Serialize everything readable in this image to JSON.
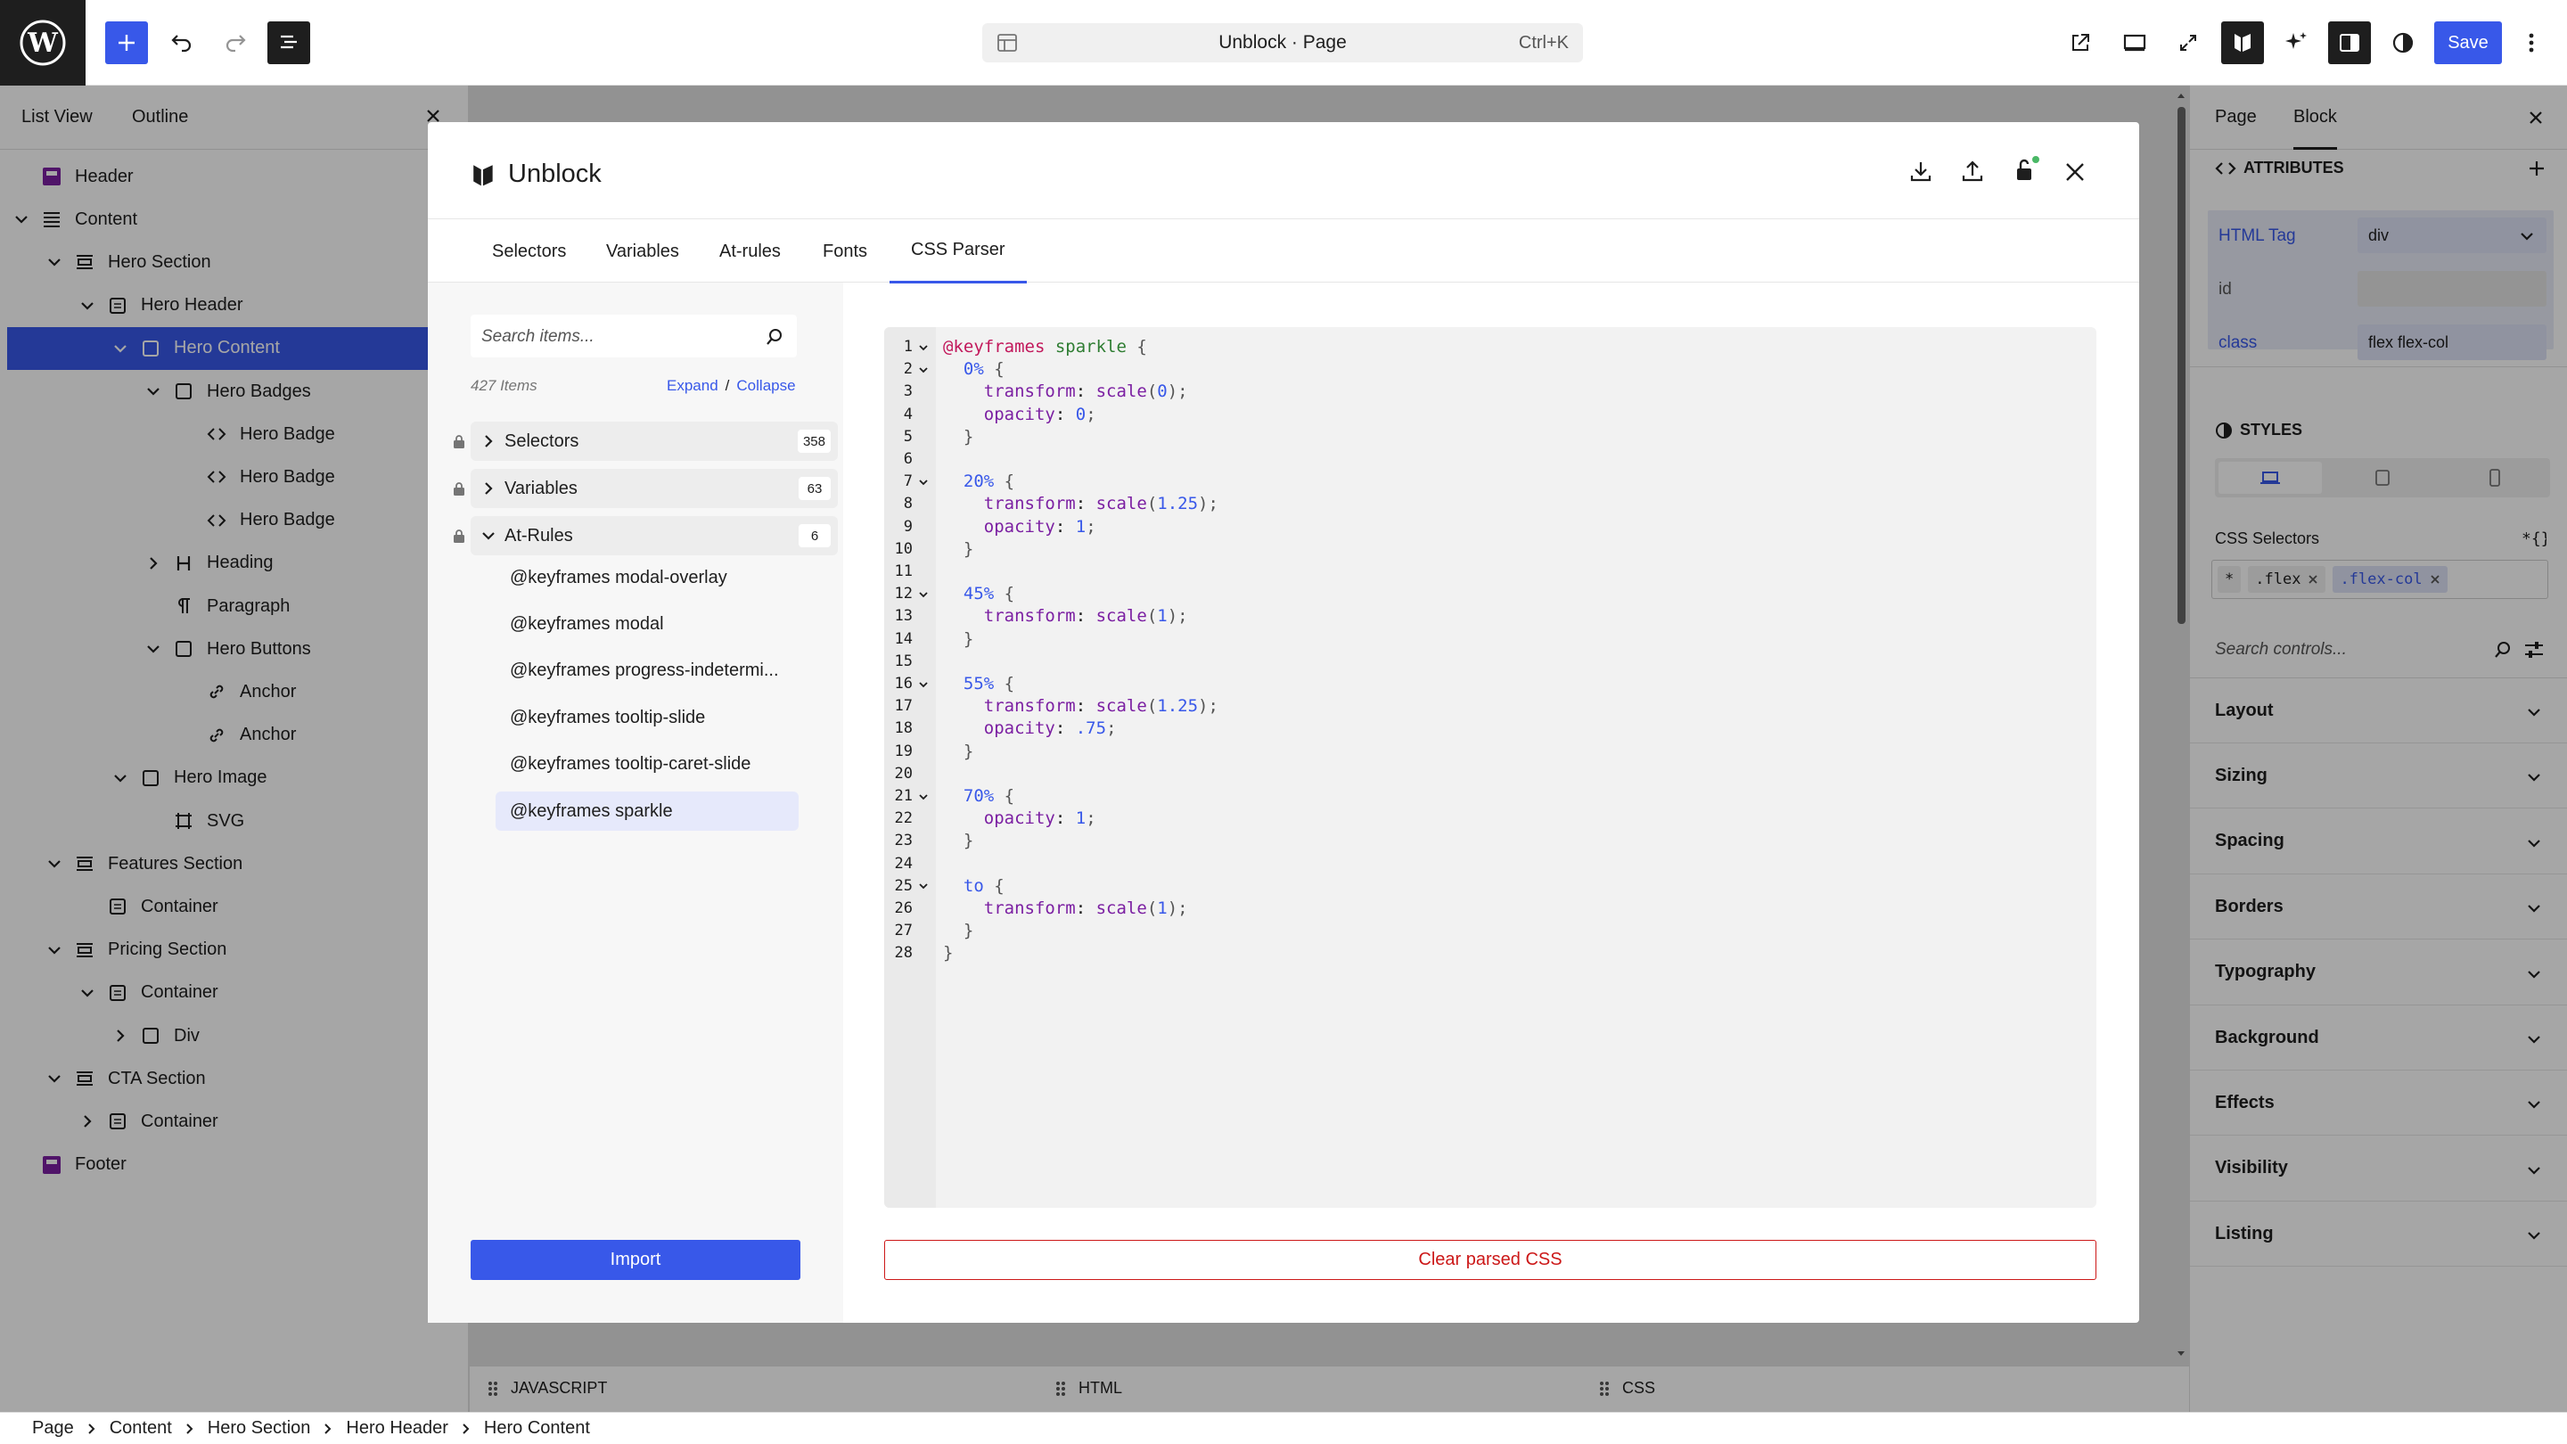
{
  "topbar": {
    "title": "Unblock · Page",
    "shortcut": "Ctrl+K",
    "save_label": "Save",
    "accent": "#3858e9"
  },
  "left_panel": {
    "tabs": [
      "List View",
      "Outline"
    ],
    "tree": [
      {
        "label": "Header",
        "depth": 0,
        "icon": "template-part-icon",
        "chev": "none"
      },
      {
        "label": "Content",
        "depth": 0,
        "icon": "paragraph-lines-icon",
        "chev": "down"
      },
      {
        "label": "Hero Section",
        "depth": 1,
        "icon": "section-icon",
        "chev": "down"
      },
      {
        "label": "Hero Header",
        "depth": 2,
        "icon": "container-icon",
        "chev": "down"
      },
      {
        "label": "Hero Content",
        "depth": 3,
        "icon": "div-icon",
        "chev": "down",
        "selected": true
      },
      {
        "label": "Hero Badges",
        "depth": 4,
        "icon": "div-icon",
        "chev": "down"
      },
      {
        "label": "Hero Badge",
        "depth": 5,
        "icon": "code-icon",
        "chev": "none"
      },
      {
        "label": "Hero Badge",
        "depth": 5,
        "icon": "code-icon",
        "chev": "none"
      },
      {
        "label": "Hero Badge",
        "depth": 5,
        "icon": "code-icon",
        "chev": "none"
      },
      {
        "label": "Heading",
        "depth": 4,
        "icon": "heading-icon",
        "chev": "right"
      },
      {
        "label": "Paragraph",
        "depth": 4,
        "icon": "pilcrow-icon",
        "chev": "none"
      },
      {
        "label": "Hero Buttons",
        "depth": 4,
        "icon": "div-icon",
        "chev": "down"
      },
      {
        "label": "Anchor",
        "depth": 5,
        "icon": "link-icon",
        "chev": "none"
      },
      {
        "label": "Anchor",
        "depth": 5,
        "icon": "link-icon",
        "chev": "none"
      },
      {
        "label": "Hero Image",
        "depth": 3,
        "icon": "div-icon",
        "chev": "down"
      },
      {
        "label": "SVG",
        "depth": 4,
        "icon": "svg-icon",
        "chev": "none"
      },
      {
        "label": "Features Section",
        "depth": 1,
        "icon": "section-icon",
        "chev": "down"
      },
      {
        "label": "Container",
        "depth": 2,
        "icon": "container-icon",
        "chev": "none"
      },
      {
        "label": "Pricing Section",
        "depth": 1,
        "icon": "section-icon",
        "chev": "down"
      },
      {
        "label": "Container",
        "depth": 2,
        "icon": "container-icon",
        "chev": "down"
      },
      {
        "label": "Div",
        "depth": 3,
        "icon": "div-icon",
        "chev": "right"
      },
      {
        "label": "CTA Section",
        "depth": 1,
        "icon": "section-icon",
        "chev": "down"
      },
      {
        "label": "Container",
        "depth": 2,
        "icon": "container-icon",
        "chev": "right"
      },
      {
        "label": "Footer",
        "depth": 0,
        "icon": "template-part-icon",
        "chev": "none"
      }
    ]
  },
  "modal": {
    "title": "Unblock",
    "tabs": [
      "Selectors",
      "Variables",
      "At-rules",
      "Fonts",
      "CSS Parser"
    ],
    "active_tab": "CSS Parser",
    "search_placeholder": "Search items...",
    "item_count": "427 Items",
    "expand": "Expand",
    "sep": "/",
    "collapse": "Collapse",
    "groups": [
      {
        "label": "Selectors",
        "count": "358",
        "open": false
      },
      {
        "label": "Variables",
        "count": "63",
        "open": false
      },
      {
        "label": "At-Rules",
        "count": "6",
        "open": true
      }
    ],
    "at_rules": [
      "@keyframes modal-overlay",
      "@keyframes modal",
      "@keyframes progress-indetermi...",
      "@keyframes tooltip-slide",
      "@keyframes tooltip-caret-slide",
      "@keyframes sparkle"
    ],
    "selected_at_rule": "@keyframes sparkle",
    "import_label": "Import",
    "clear_label": "Clear parsed CSS",
    "code_lines": [
      [
        [
          "@keyframes",
          "at"
        ],
        [
          " ",
          ""
        ],
        [
          "sparkle",
          "id"
        ],
        [
          " {",
          "p"
        ]
      ],
      [
        [
          "  ",
          ""
        ],
        [
          "0%",
          "pct"
        ],
        [
          " {",
          "p"
        ]
      ],
      [
        [
          "    ",
          ""
        ],
        [
          "transform",
          "prop"
        ],
        [
          ": ",
          ""
        ],
        [
          "scale",
          "fn"
        ],
        [
          "(",
          "p"
        ],
        [
          "0",
          "num"
        ],
        [
          ");",
          "p"
        ]
      ],
      [
        [
          "    ",
          ""
        ],
        [
          "opacity",
          "prop"
        ],
        [
          ": ",
          ""
        ],
        [
          "0",
          "num"
        ],
        [
          ";",
          "p"
        ]
      ],
      [
        [
          "  ",
          ""
        ],
        [
          "}",
          "p"
        ]
      ],
      [],
      [
        [
          "  ",
          ""
        ],
        [
          "20%",
          "pct"
        ],
        [
          " {",
          "p"
        ]
      ],
      [
        [
          "    ",
          ""
        ],
        [
          "transform",
          "prop"
        ],
        [
          ": ",
          ""
        ],
        [
          "scale",
          "fn"
        ],
        [
          "(",
          "p"
        ],
        [
          "1.25",
          "num"
        ],
        [
          ");",
          "p"
        ]
      ],
      [
        [
          "    ",
          ""
        ],
        [
          "opacity",
          "prop"
        ],
        [
          ": ",
          ""
        ],
        [
          "1",
          "num"
        ],
        [
          ";",
          "p"
        ]
      ],
      [
        [
          "  ",
          ""
        ],
        [
          "}",
          "p"
        ]
      ],
      [],
      [
        [
          "  ",
          ""
        ],
        [
          "45%",
          "pct"
        ],
        [
          " {",
          "p"
        ]
      ],
      [
        [
          "    ",
          ""
        ],
        [
          "transform",
          "prop"
        ],
        [
          ": ",
          ""
        ],
        [
          "scale",
          "fn"
        ],
        [
          "(",
          "p"
        ],
        [
          "1",
          "num"
        ],
        [
          ");",
          "p"
        ]
      ],
      [
        [
          "  ",
          ""
        ],
        [
          "}",
          "p"
        ]
      ],
      [],
      [
        [
          "  ",
          ""
        ],
        [
          "55%",
          "pct"
        ],
        [
          " {",
          "p"
        ]
      ],
      [
        [
          "    ",
          ""
        ],
        [
          "transform",
          "prop"
        ],
        [
          ": ",
          ""
        ],
        [
          "scale",
          "fn"
        ],
        [
          "(",
          "p"
        ],
        [
          "1.25",
          "num"
        ],
        [
          ");",
          "p"
        ]
      ],
      [
        [
          "    ",
          ""
        ],
        [
          "opacity",
          "prop"
        ],
        [
          ": ",
          ""
        ],
        [
          ".75",
          "num"
        ],
        [
          ";",
          "p"
        ]
      ],
      [
        [
          "  ",
          ""
        ],
        [
          "}",
          "p"
        ]
      ],
      [],
      [
        [
          "  ",
          ""
        ],
        [
          "70%",
          "pct"
        ],
        [
          " {",
          "p"
        ]
      ],
      [
        [
          "    ",
          ""
        ],
        [
          "opacity",
          "prop"
        ],
        [
          ": ",
          ""
        ],
        [
          "1",
          "num"
        ],
        [
          ";",
          "p"
        ]
      ],
      [
        [
          "  ",
          ""
        ],
        [
          "}",
          "p"
        ]
      ],
      [],
      [
        [
          "  ",
          ""
        ],
        [
          "to",
          "pct"
        ],
        [
          " {",
          "p"
        ]
      ],
      [
        [
          "    ",
          ""
        ],
        [
          "transform",
          "prop"
        ],
        [
          ": ",
          ""
        ],
        [
          "scale",
          "fn"
        ],
        [
          "(",
          "p"
        ],
        [
          "1",
          "num"
        ],
        [
          ");",
          "p"
        ]
      ],
      [
        [
          "  ",
          ""
        ],
        [
          "}",
          "p"
        ]
      ],
      [
        [
          "}",
          "p"
        ]
      ]
    ],
    "fold_lines": [
      1,
      2,
      7,
      12,
      16,
      21,
      25
    ]
  },
  "right_panel": {
    "tabs": [
      "Page",
      "Block"
    ],
    "attributes_heading": "ATTRIBUTES",
    "attributes": [
      {
        "label": "HTML Tag",
        "value": "div",
        "highlight": true
      },
      {
        "label": "id",
        "value": "",
        "highlight": false
      },
      {
        "label": "class",
        "value": "flex flex-col",
        "highlight": true
      }
    ],
    "styles_heading": "STYLES",
    "css_selectors_label": "CSS Selectors",
    "selector_chips": [
      "*",
      ".flex",
      ".flex-col"
    ],
    "search_controls_placeholder": "Search controls...",
    "sections": [
      "Layout",
      "Sizing",
      "Spacing",
      "Borders",
      "Typography",
      "Background",
      "Effects",
      "Visibility",
      "Listing"
    ]
  },
  "bottom_tabs": [
    "JAVASCRIPT",
    "HTML",
    "CSS"
  ],
  "breadcrumb": [
    "Page",
    "Content",
    "Hero Section",
    "Hero Header",
    "Hero Content"
  ]
}
